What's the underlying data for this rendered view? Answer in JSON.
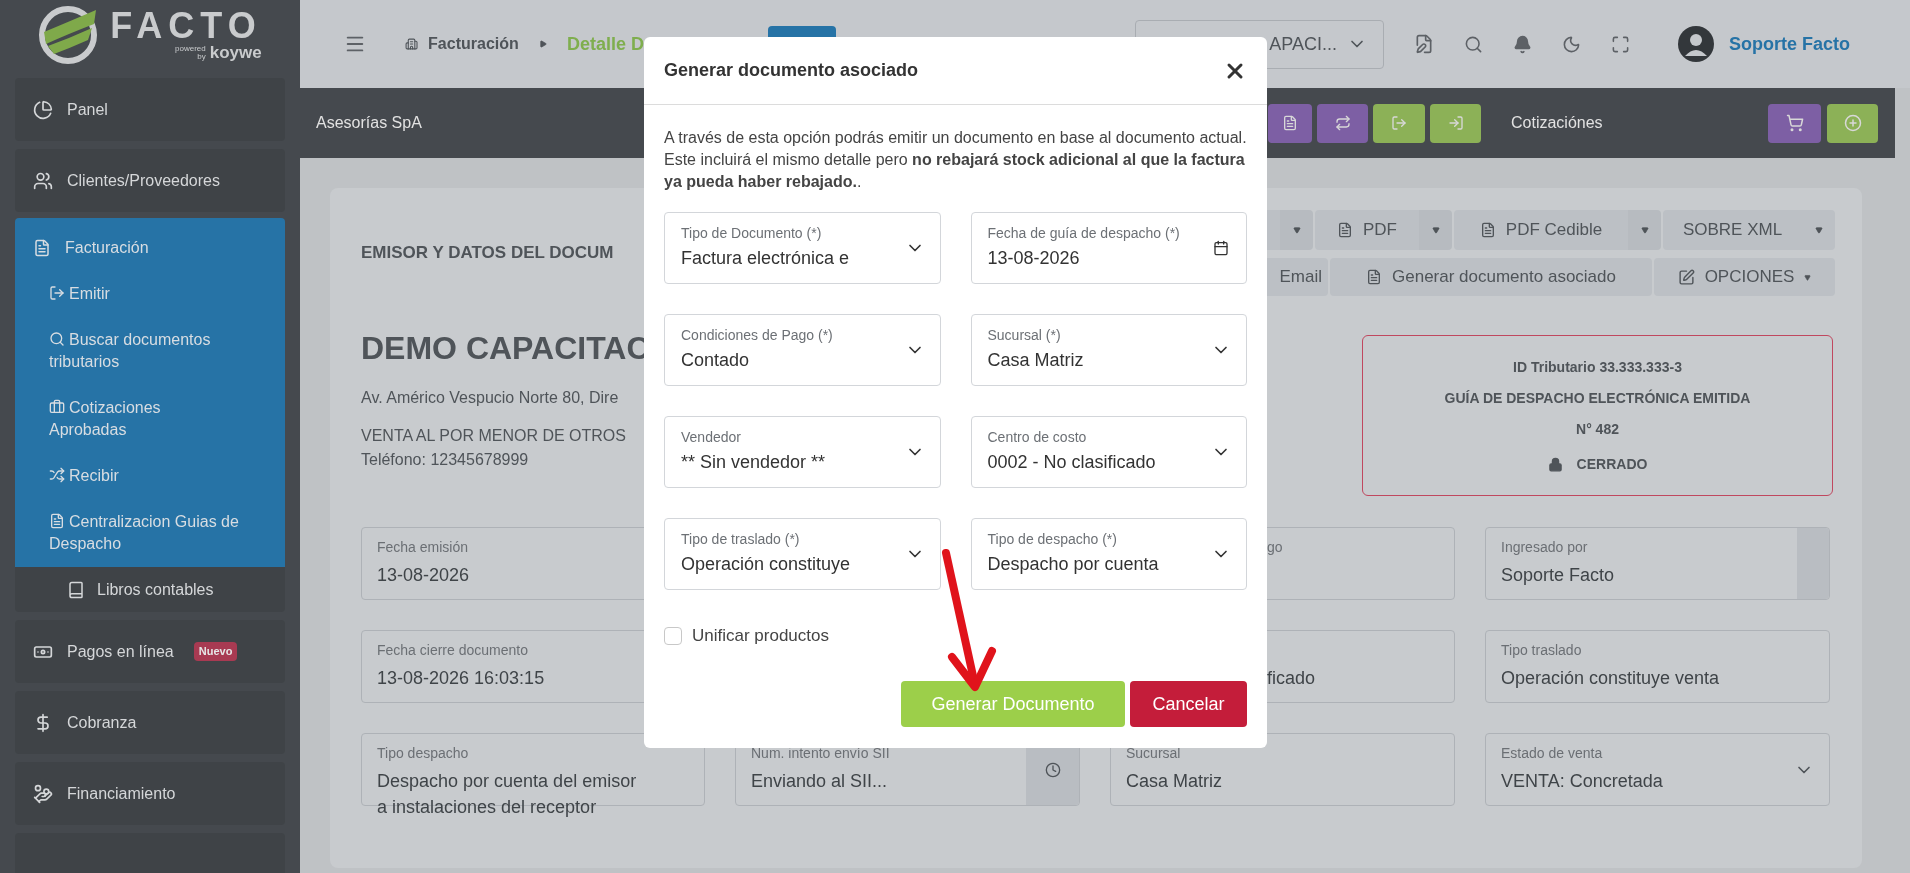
{
  "sidebar": {
    "logo": {
      "wordmark": "FACTO",
      "powered": "powered",
      "by": "by",
      "brand": "koywe"
    },
    "items": [
      {
        "label": "Panel",
        "selected": false
      },
      {
        "label": "Clientes/Proveedores",
        "selected": false
      },
      {
        "label": "Facturación",
        "selected": true,
        "expanded": true,
        "children": [
          {
            "label": "Emitir",
            "kind": "link"
          },
          {
            "label": "Buscar documentos tributarios",
            "kind": "link"
          },
          {
            "label": "Cotizaciones Aprobadas",
            "kind": "link"
          },
          {
            "label": "Recibir",
            "kind": "link"
          },
          {
            "label": "Centralizacion Guias de Despacho",
            "kind": "link"
          },
          {
            "label": "Libros contables",
            "kind": "card"
          }
        ]
      },
      {
        "label": "Pagos en línea",
        "selected": false,
        "badge": "Nuevo"
      },
      {
        "label": "Cobranza",
        "selected": false
      },
      {
        "label": "Financiamiento",
        "selected": false
      }
    ]
  },
  "header": {
    "breadcrumb": [
      {
        "label": "Facturación",
        "selected": false
      },
      {
        "label": "Detalle D",
        "selected": true
      }
    ],
    "company_select": {
      "value": "APACI..."
    },
    "user": {
      "name": "Soporte Facto"
    }
  },
  "toolbar": {
    "company": "Asesorías SpA",
    "section": "Cotizaciónes"
  },
  "document": {
    "heading": "EMISOR Y DATOS DEL DOCUM",
    "actions_row1": [
      {
        "kind": "caret"
      },
      {
        "kind": "split",
        "label": "PDF"
      },
      {
        "kind": "split",
        "label": "PDF Cedible"
      },
      {
        "kind": "split-plain",
        "label": "SOBRE XML"
      }
    ],
    "actions_row2": [
      {
        "kind": "plain",
        "label": "Email"
      },
      {
        "kind": "file",
        "label": "Generar documento asociado"
      },
      {
        "kind": "dropdown",
        "label": "OPCIONES"
      }
    ],
    "issuer": {
      "name": "DEMO CAPACITAC",
      "address": "Av. Américo Vespucio Norte 80, Dire",
      "activity": "VENTA AL POR MENOR DE OTROS",
      "phone": "Teléfono: 12345678999"
    },
    "status_box": {
      "tax_id": "ID Tributario 33.333.333-3",
      "doc_type": "GUÍA DE DESPACHO ELECTRÓNICA EMITIDA",
      "number": "N° 482",
      "state": "CERRADO"
    },
    "fields": [
      {
        "kind": "text",
        "label": "Fecha emisión",
        "value": "13-08-2026"
      },
      {
        "kind": "covered"
      },
      {
        "kind": "partial",
        "label": "go"
      },
      {
        "kind": "addon",
        "label": "Ingresado por",
        "value": "Soporte Facto"
      },
      {
        "kind": "text",
        "label": "Fecha cierre documento",
        "value": "13-08-2026 16:03:15"
      },
      {
        "kind": "covered"
      },
      {
        "kind": "partial",
        "value": "ficado"
      },
      {
        "kind": "text",
        "label": "Tipo traslado",
        "value": "Operación constituye venta"
      },
      {
        "kind": "text",
        "label": "Tipo despacho",
        "value": "Despacho por cuenta del emisor a instalaciones del receptor"
      },
      {
        "kind": "clock",
        "label": "Num. intento envío SII",
        "value": "Enviando al SII..."
      },
      {
        "kind": "text",
        "label": "Sucursal",
        "value": "Casa Matriz"
      },
      {
        "kind": "select",
        "label": "Estado de venta",
        "value": "VENTA: Concretada"
      }
    ]
  },
  "modal": {
    "title": "Generar documento asociado",
    "description": "A través de esta opción podrás emitir un documento en base al documento actual. Este incluirá el mismo detalle pero **no rebajará stock adicional al que la factura ya pueda haber rebajado.**.",
    "fields": [
      {
        "kind": "select",
        "label": "Tipo de Documento (*)",
        "value": "Factura electrónica e"
      },
      {
        "kind": "date",
        "label": "Fecha de guía de despacho (*)",
        "value": "13-08-2026"
      },
      {
        "kind": "select",
        "label": "Condiciones de Pago (*)",
        "value": "Contado"
      },
      {
        "kind": "select",
        "label": "Sucursal (*)",
        "value": "Casa Matriz"
      },
      {
        "kind": "select",
        "label": "Vendedor",
        "value": "** Sin vendedor **"
      },
      {
        "kind": "select",
        "label": "Centro de costo",
        "value": "0002 - No clasificado"
      },
      {
        "kind": "select",
        "label": "Tipo de traslado (*)",
        "value": "Operación constituye"
      },
      {
        "kind": "select",
        "label": "Tipo de despacho (*)",
        "value": "Despacho por cuenta"
      }
    ],
    "checkbox": {
      "label": "Unificar productos",
      "checked": false
    },
    "buttons": [
      {
        "kind": "primary",
        "label": "Generar Documento"
      },
      {
        "kind": "danger",
        "label": "Cancelar"
      }
    ]
  }
}
